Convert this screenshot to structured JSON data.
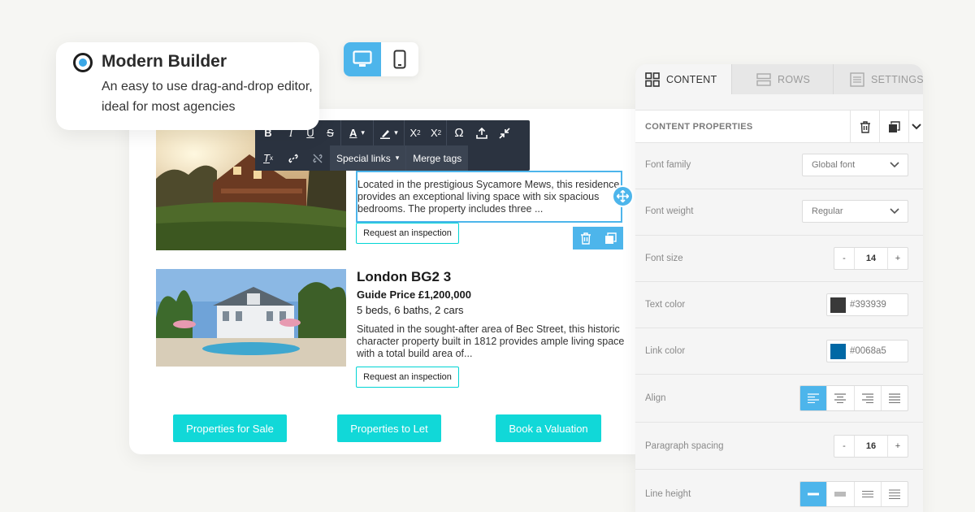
{
  "feature": {
    "title": "Modern Builder",
    "description": "An easy to use drag-and-drop editor, ideal for most agencies"
  },
  "device_toggle": {
    "active": "desktop",
    "icons": [
      "desktop-icon",
      "mobile-icon"
    ]
  },
  "toolbar": {
    "row2_dropdowns": [
      "Special links",
      "Merge tags"
    ],
    "icons": [
      "bold-icon",
      "italic-icon",
      "underline-icon",
      "strikethrough-icon",
      "text-color-icon",
      "highlight-icon",
      "superscript-icon",
      "subscript-icon",
      "special-char-icon",
      "upload-icon",
      "collapse-icon",
      "clear-format-icon",
      "link-icon",
      "unlink-icon"
    ]
  },
  "listings": [
    {
      "description": "Located in the prestigious Sycamore Mews, this residence provides an exceptional living space with six spacious bedrooms. The property includes three ...",
      "button": "Request an inspection"
    },
    {
      "title": "London BG2 3",
      "price": "Guide Price £1,200,000",
      "meta": "5 beds, 6 baths, 2 cars",
      "description": "Situated in the sought-after area of Bec Street, this historic character property built in 1812 provides ample living space with a total build area of...",
      "button": "Request an inspection"
    }
  ],
  "cta_buttons": [
    "Properties for Sale",
    "Properties to Let",
    "Book a Valuation"
  ],
  "panel": {
    "tabs": [
      "CONTENT",
      "ROWS",
      "SETTINGS"
    ],
    "active_tab": "CONTENT",
    "section_title": "CONTENT PROPERTIES",
    "properties": {
      "font_family": {
        "label": "Font family",
        "value": "Global font"
      },
      "font_weight": {
        "label": "Font weight",
        "value": "Regular"
      },
      "font_size": {
        "label": "Font size",
        "value": "14",
        "minus": "-",
        "plus": "+"
      },
      "text_color": {
        "label": "Text color",
        "value": "#393939"
      },
      "link_color": {
        "label": "Link color",
        "value": "#0068a5"
      },
      "align": {
        "label": "Align",
        "selected": "left"
      },
      "paragraph_spacing": {
        "label": "Paragraph spacing",
        "value": "16",
        "minus": "-",
        "plus": "+"
      },
      "line_height": {
        "label": "Line height",
        "selected": "1"
      }
    }
  },
  "colors": {
    "accent": "#4db5eb",
    "cta": "#11d8d8",
    "toolbar": "#2b3340"
  }
}
